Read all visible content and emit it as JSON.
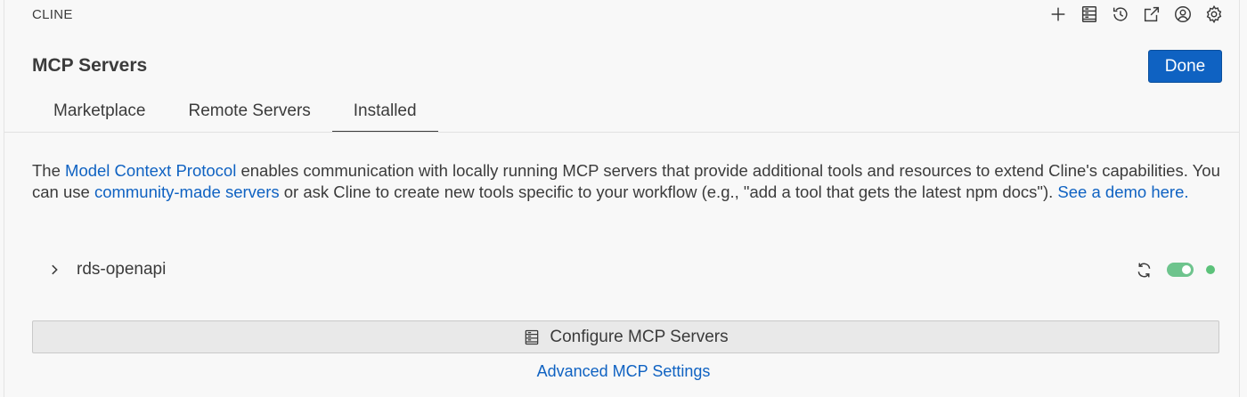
{
  "app": {
    "title": "CLINE"
  },
  "toolbar": {
    "icons": [
      "plus-icon",
      "server-icon",
      "history-icon",
      "popout-icon",
      "account-icon",
      "gear-icon"
    ]
  },
  "header": {
    "title": "MCP Servers",
    "done_label": "Done"
  },
  "tabs": [
    {
      "label": "Marketplace",
      "active": false
    },
    {
      "label": "Remote Servers",
      "active": false
    },
    {
      "label": "Installed",
      "active": true
    }
  ],
  "description": {
    "part1": "The ",
    "link1": "Model Context Protocol",
    "part2": " enables communication with locally running MCP servers that provide additional tools and resources to extend Cline's capabilities. You can use ",
    "link2": "community-made servers",
    "part3": " or ask Cline to create new tools specific to your workflow (e.g., \"add a tool that gets the latest npm docs\"). ",
    "link3": "See a demo here."
  },
  "servers": [
    {
      "name": "rds-openapi",
      "enabled": true,
      "status_color": "#5cc27a"
    }
  ],
  "footer": {
    "configure_label": "Configure MCP Servers",
    "advanced_label": "Advanced MCP Settings"
  },
  "colors": {
    "accent": "#0f62c2",
    "toggle_on": "#6ec48d",
    "status_ok": "#5cc27a"
  }
}
